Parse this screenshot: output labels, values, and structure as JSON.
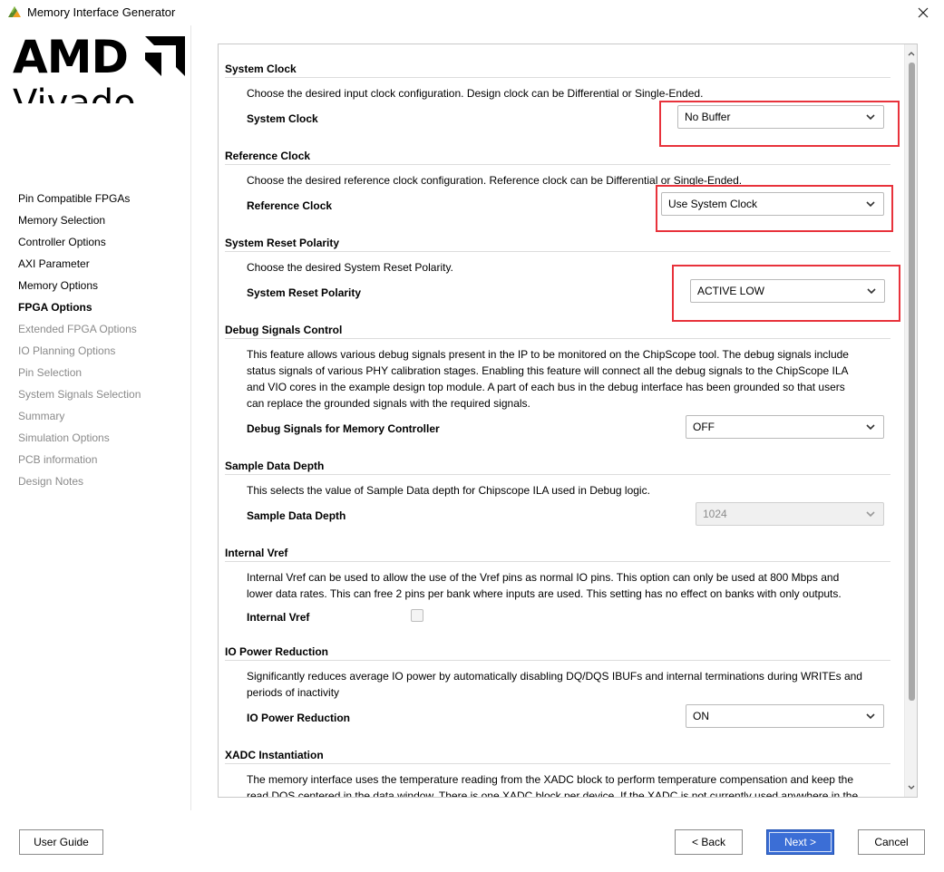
{
  "window": {
    "title": "Memory Interface Generator"
  },
  "brand": {
    "company": "AMD",
    "product": "Vivado"
  },
  "sidebar": {
    "items": [
      {
        "label": "Pin Compatible FPGAs",
        "state": "normal"
      },
      {
        "label": "Memory Selection",
        "state": "normal"
      },
      {
        "label": "Controller Options",
        "state": "normal"
      },
      {
        "label": "AXI Parameter",
        "state": "normal"
      },
      {
        "label": "Memory Options",
        "state": "normal"
      },
      {
        "label": "FPGA Options",
        "state": "active"
      },
      {
        "label": "Extended FPGA Options",
        "state": "disabled"
      },
      {
        "label": "IO Planning Options",
        "state": "disabled"
      },
      {
        "label": "Pin Selection",
        "state": "disabled"
      },
      {
        "label": "System Signals Selection",
        "state": "disabled"
      },
      {
        "label": "Summary",
        "state": "disabled"
      },
      {
        "label": "Simulation Options",
        "state": "disabled"
      },
      {
        "label": "PCB information",
        "state": "disabled"
      },
      {
        "label": "Design Notes",
        "state": "disabled"
      }
    ]
  },
  "sections": {
    "system_clock": {
      "title": "System Clock",
      "desc": "Choose the desired input clock configuration. Design clock can be Differential or Single-Ended.",
      "label": "System Clock",
      "value": "No Buffer"
    },
    "reference_clock": {
      "title": "Reference Clock",
      "desc": "Choose the desired reference clock configuration. Reference clock can be Differential or Single-Ended.",
      "label": "Reference Clock",
      "value": "Use System Clock"
    },
    "reset_polarity": {
      "title": "System Reset Polarity",
      "desc": "Choose the desired System Reset Polarity.",
      "label": "System Reset Polarity",
      "value": "ACTIVE LOW"
    },
    "debug": {
      "title": "Debug Signals Control",
      "desc_lines": [
        "This feature allows various debug signals present in the IP to be monitored on the ChipScope tool. The debug signals include",
        "status signals of various PHY calibration stages. Enabling this feature will connect all the debug signals to the ChipScope ILA",
        "and VIO cores in the example design top module. A part of each bus in the debug interface has been grounded so that users",
        "can replace the grounded signals with the required signals."
      ],
      "label": "Debug Signals for Memory Controller",
      "value": "OFF"
    },
    "sample_depth": {
      "title": "Sample Data Depth",
      "desc": "This selects the value of Sample Data depth for Chipscope ILA used in Debug logic.",
      "label": "Sample Data Depth",
      "value": "1024"
    },
    "vref": {
      "title": "Internal Vref",
      "desc_lines": [
        "Internal Vref can be used to allow the use of the Vref pins as normal IO pins. This option can only be used at 800 Mbps and",
        "lower data rates. This can free 2 pins per bank where inputs are used. This setting has no effect on banks with only outputs."
      ],
      "label": "Internal Vref",
      "checked": false
    },
    "power": {
      "title": "IO Power Reduction",
      "desc_lines": [
        "Significantly reduces average IO power by automatically disabling DQ/DQS IBUFs and internal terminations during WRITEs and",
        "periods of inactivity"
      ],
      "label": "IO Power Reduction",
      "value": "ON"
    },
    "xadc": {
      "title": "XADC Instantiation",
      "desc_lines": [
        "The memory interface uses the temperature reading from the XADC block to perform temperature compensation and keep the",
        "read DQS centered in the data window. There is one XADC block per device. If the XADC is not currently used anywhere in the"
      ]
    }
  },
  "footer": {
    "user_guide": "User Guide",
    "back": "< Back",
    "next": "Next >",
    "cancel": "Cancel"
  },
  "colors": {
    "highlight_box": "#e8323b",
    "primary_button": "#3b6ed6",
    "disabled_text": "#8a8a8a"
  }
}
